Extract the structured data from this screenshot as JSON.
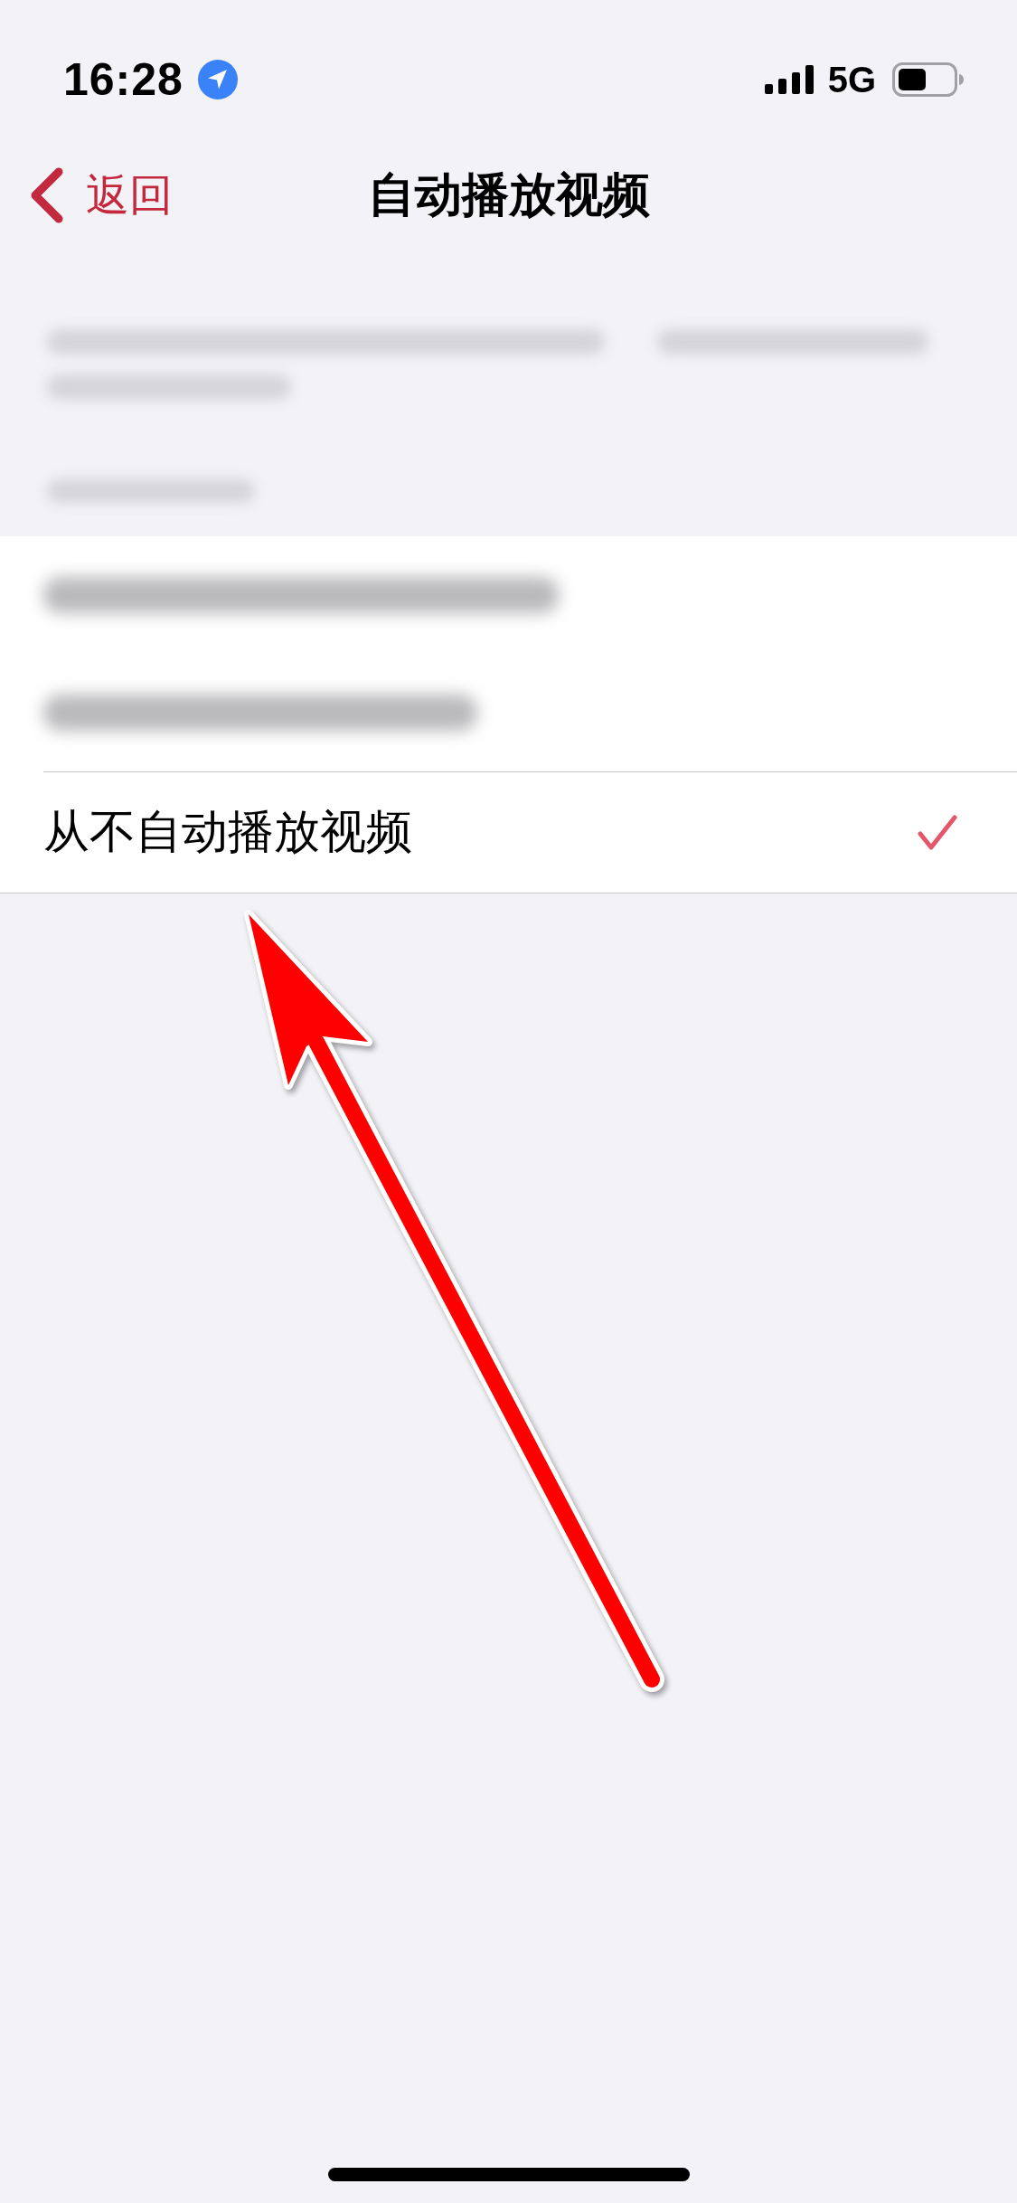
{
  "status_bar": {
    "time": "16:28",
    "network": "5G"
  },
  "nav_bar": {
    "back_label": "返回",
    "title": "自动播放视频"
  },
  "description": {
    "kind": "redacted"
  },
  "section_header": {
    "kind": "redacted"
  },
  "options": [
    {
      "kind": "redacted",
      "selected": false
    },
    {
      "kind": "redacted",
      "selected": false
    },
    {
      "kind": "text",
      "label": "从不自动播放视频",
      "selected": true
    }
  ],
  "annotation": {
    "kind": "arrow"
  }
}
